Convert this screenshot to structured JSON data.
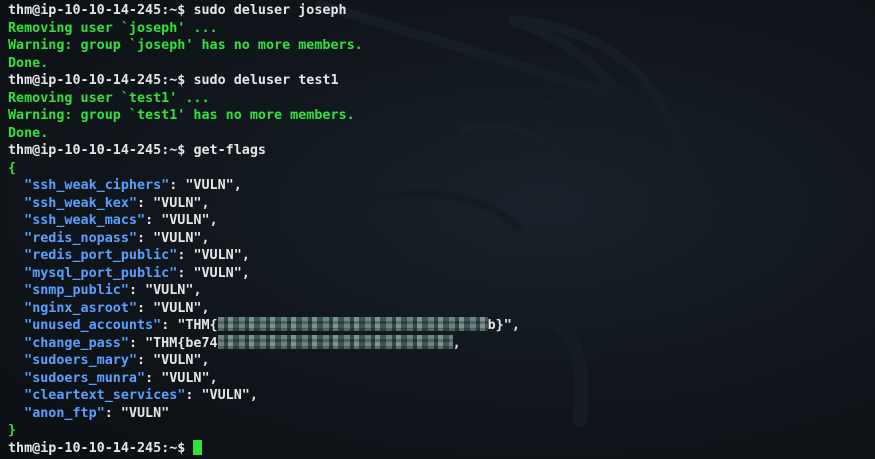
{
  "prompt": {
    "user_host": "thm@ip-10-10-14-245",
    "separator": ":~$ "
  },
  "session": [
    {
      "command": "sudo deluser joseph"
    },
    {
      "output": "Removing user `joseph' ..."
    },
    {
      "output": "Warning: group `joseph' has no more members."
    },
    {
      "output": "Done."
    },
    {
      "command": "sudo deluser test1"
    },
    {
      "output": "Removing user `test1' ..."
    },
    {
      "output": "Warning: group `test1' has no more members."
    },
    {
      "output": "Done."
    },
    {
      "command": "get-flags"
    }
  ],
  "json_output": {
    "open_brace": "{",
    "close_brace": "}",
    "entries": [
      {
        "key": "ssh_weak_ciphers",
        "value": "\"VULN\"",
        "comma": ","
      },
      {
        "key": "ssh_weak_kex",
        "value": "\"VULN\"",
        "comma": ","
      },
      {
        "key": "ssh_weak_macs",
        "value": "\"VULN\"",
        "comma": ","
      },
      {
        "key": "redis_nopass",
        "value": "\"VULN\"",
        "comma": ","
      },
      {
        "key": "redis_port_public",
        "value": "\"VULN\"",
        "comma": ","
      },
      {
        "key": "mysql_port_public",
        "value": "\"VULN\"",
        "comma": ","
      },
      {
        "key": "snmp_public",
        "value": "\"VULN\"",
        "comma": ","
      },
      {
        "key": "nginx_asroot",
        "value": "\"VULN\"",
        "comma": ","
      },
      {
        "key": "unused_accounts",
        "value_prefix": "\"THM{",
        "redacted": true,
        "value_suffix": "b}\"",
        "comma": ","
      },
      {
        "key": "change_pass",
        "value_prefix": "\"THM{be74",
        "redacted": true,
        "value_suffix": "",
        "comma": ","
      },
      {
        "key": "sudoers_mary",
        "value": "\"VULN\"",
        "comma": ","
      },
      {
        "key": "sudoers_munra",
        "value": "\"VULN\"",
        "comma": ","
      },
      {
        "key": "cleartext_services",
        "value": "\"VULN\"",
        "comma": ","
      },
      {
        "key": "anon_ftp",
        "value": "\"VULN\"",
        "comma": ""
      }
    ]
  },
  "colors": {
    "background": "#11171d",
    "output_green": "#31e23a",
    "json_key_blue": "#5aa0ff",
    "text_white": "#e6e6e6"
  }
}
